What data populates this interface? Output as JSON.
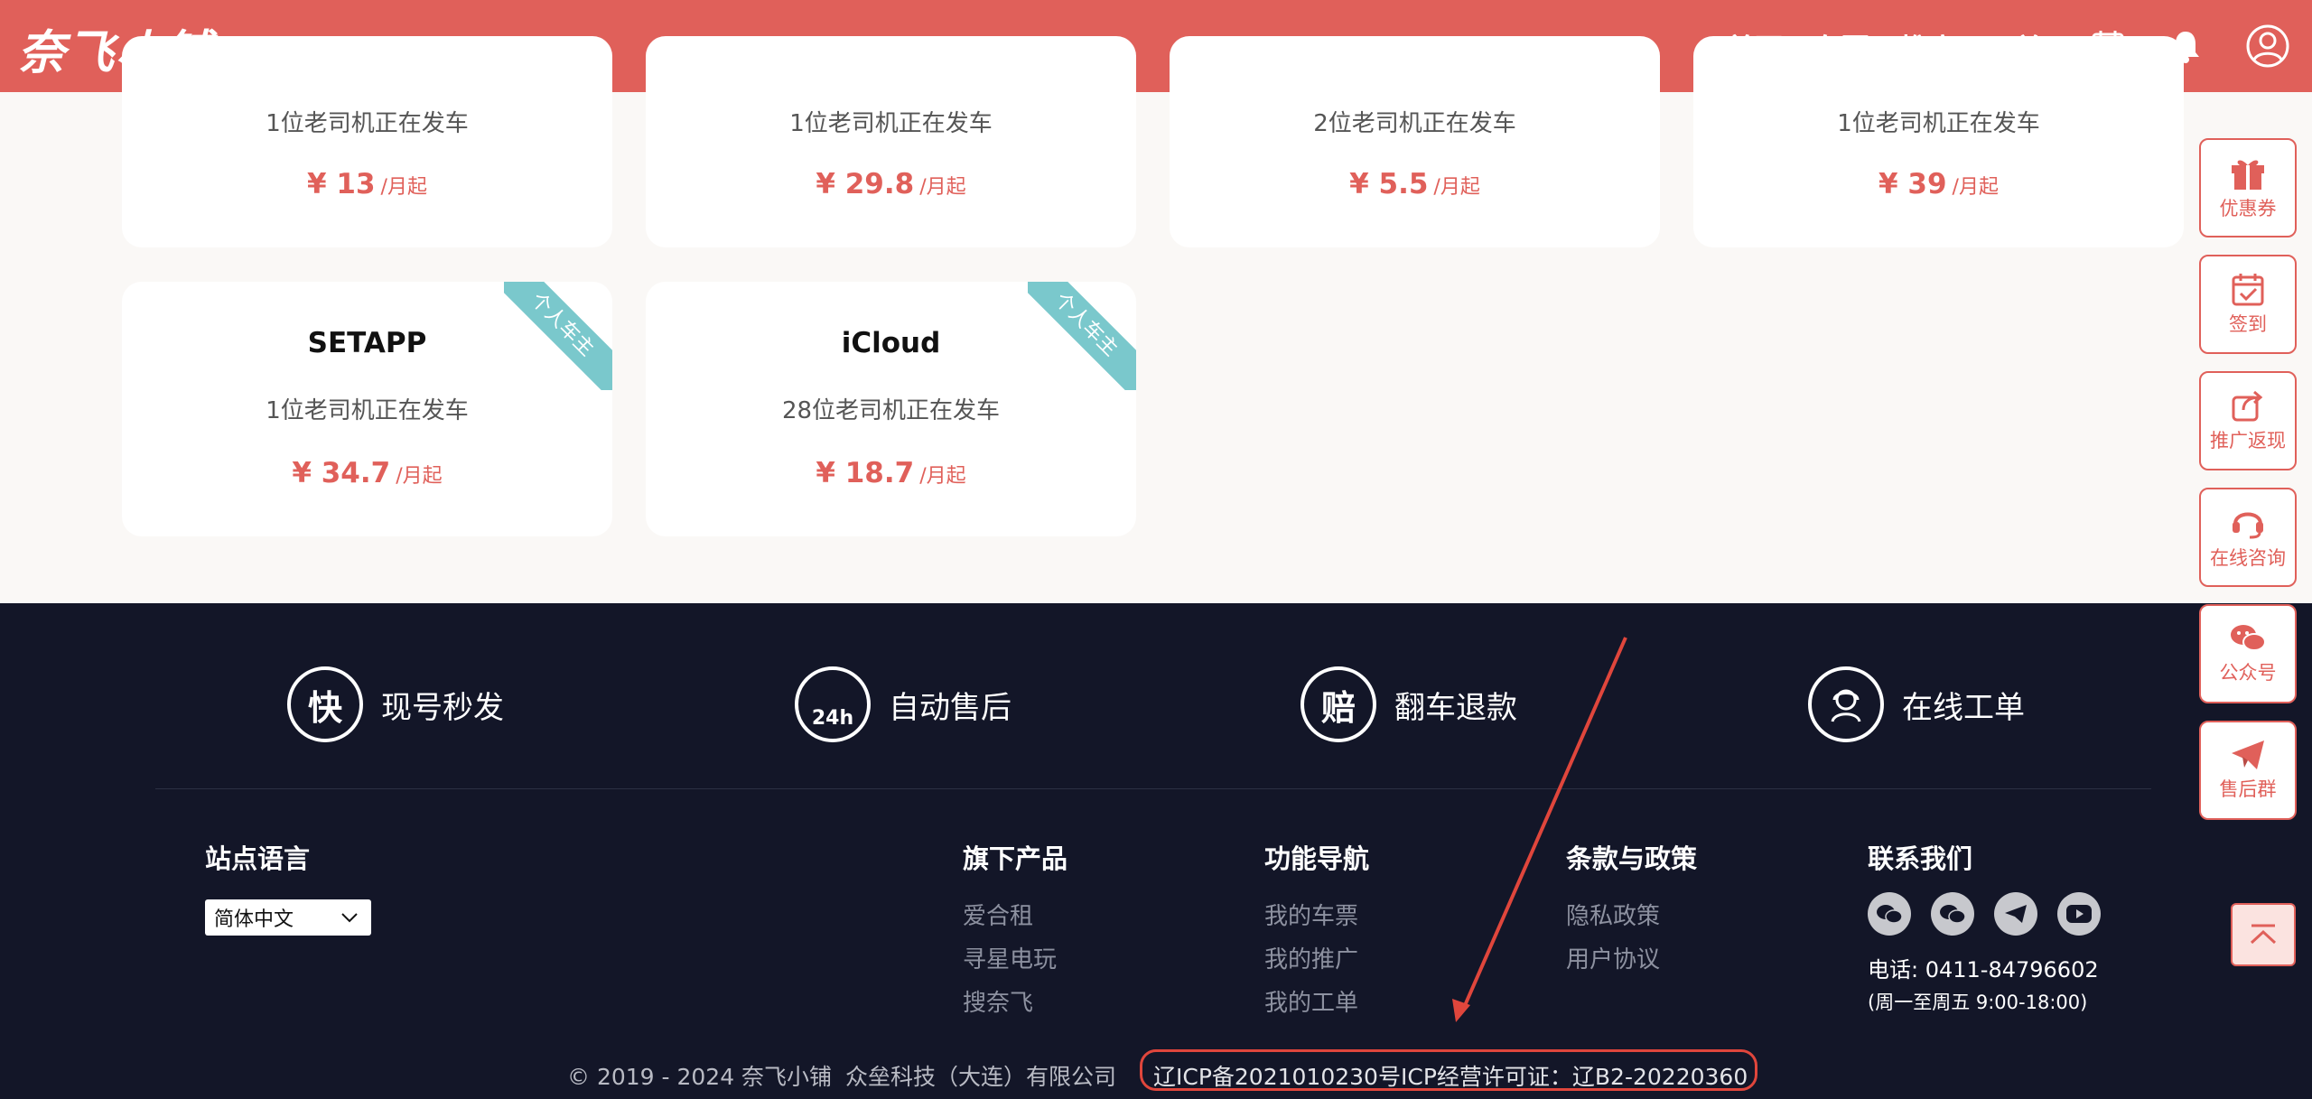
{
  "header": {
    "logo": "奈飞小铺",
    "nav": [
      "首页",
      "车票",
      "推广",
      "工单"
    ]
  },
  "cards_top": [
    {
      "sub": "1位老司机正在发车",
      "price": "¥ 13",
      "unit": "/月起"
    },
    {
      "sub": "1位老司机正在发车",
      "price": "¥ 29.8",
      "unit": "/月起"
    },
    {
      "sub": "2位老司机正在发车",
      "price": "¥ 5.5",
      "unit": "/月起"
    },
    {
      "sub": "1位老司机正在发车",
      "price": "¥ 39",
      "unit": "/月起"
    }
  ],
  "cards_bottom": [
    {
      "name": "SETAPP",
      "sub": "1位老司机正在发车",
      "price": "¥ 34.7",
      "unit": "/月起",
      "ribbon": "个人车主"
    },
    {
      "name": "iCloud",
      "sub": "28位老司机正在发车",
      "price": "¥ 18.7",
      "unit": "/月起",
      "ribbon": "个人车主"
    }
  ],
  "sidebar": [
    "优惠券",
    "签到",
    "推广返现",
    "在线咨询",
    "公众号",
    "售后群"
  ],
  "features": [
    {
      "badge": "快",
      "label": "现号秒发"
    },
    {
      "badge": "24h",
      "label": "自动售后"
    },
    {
      "badge": "赔",
      "label": "翻车退款"
    },
    {
      "badge": "",
      "label": "在线工单"
    }
  ],
  "footer": {
    "lang_title": "站点语言",
    "lang_value": "简体中文",
    "products_title": "旗下产品",
    "products": [
      "爱合租",
      "寻星电玩",
      "搜奈飞"
    ],
    "nav_title": "功能导航",
    "nav_links": [
      "我的车票",
      "我的推广",
      "我的工单"
    ],
    "policy_title": "条款与政策",
    "policy_links": [
      "隐私政策",
      "用户协议"
    ],
    "contact_title": "联系我们",
    "phone": "电话: 0411-84796602",
    "hours": "(周一至周五 9:00-18:00)",
    "copyright": "© 2019 - 2024 奈飞小铺",
    "company": "众垒科技（大连）有限公司",
    "icp": "辽ICP备2021010230号",
    "license": "ICP经营许可证：辽B2-20220360"
  },
  "colors": {
    "brand": "#e0605a",
    "footer_bg": "#131628",
    "ribbon": "#7ac8cc",
    "annotation": "#e0463c"
  }
}
